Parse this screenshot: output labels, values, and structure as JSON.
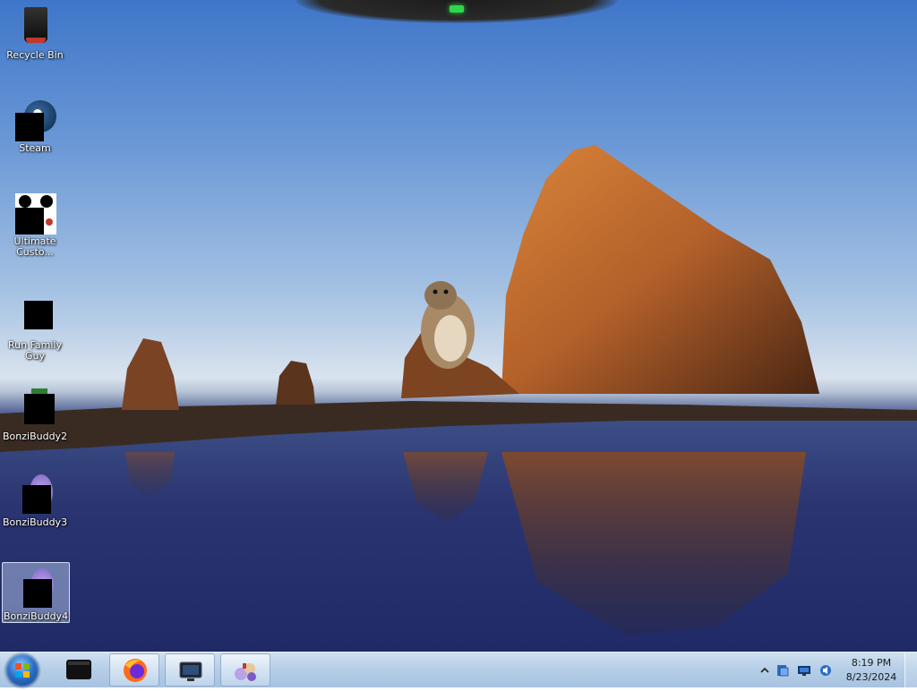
{
  "desktop": {
    "icons": [
      {
        "label": "Recycle Bin",
        "icon": "recycle-bin-icon"
      },
      {
        "label": "Steam",
        "icon": "steam-icon"
      },
      {
        "label": "Ultimate Custo...",
        "icon": "ultimate-custom-night-icon"
      },
      {
        "label": "Run Family Guy",
        "icon": "family-guy-icon"
      },
      {
        "label": "BonziBuddy2",
        "icon": "bonzibuddy-icon"
      },
      {
        "label": "BonziBuddy3",
        "icon": "bonzibuddy-icon"
      },
      {
        "label": "BonziBuddy4",
        "icon": "bonzibuddy-icon"
      }
    ]
  },
  "taskbar": {
    "pinned": [
      {
        "icon": "start-orb-icon"
      },
      {
        "icon": "dark-app-icon"
      },
      {
        "icon": "firefox-icon"
      },
      {
        "icon": "monitor-app-icon"
      },
      {
        "icon": "bonzi-app-icon"
      }
    ],
    "tray": {
      "icons": [
        "show-hidden-icons-chevron",
        "network-icon",
        "display-icon",
        "volume-icon"
      ],
      "time": "8:19 PM",
      "date": "8/23/2024"
    }
  },
  "colors": {
    "sky_top": "#3f76c9",
    "rock": "#b5652a",
    "taskbar": "#b7cfe8",
    "accent_led": "#2fd84a"
  }
}
